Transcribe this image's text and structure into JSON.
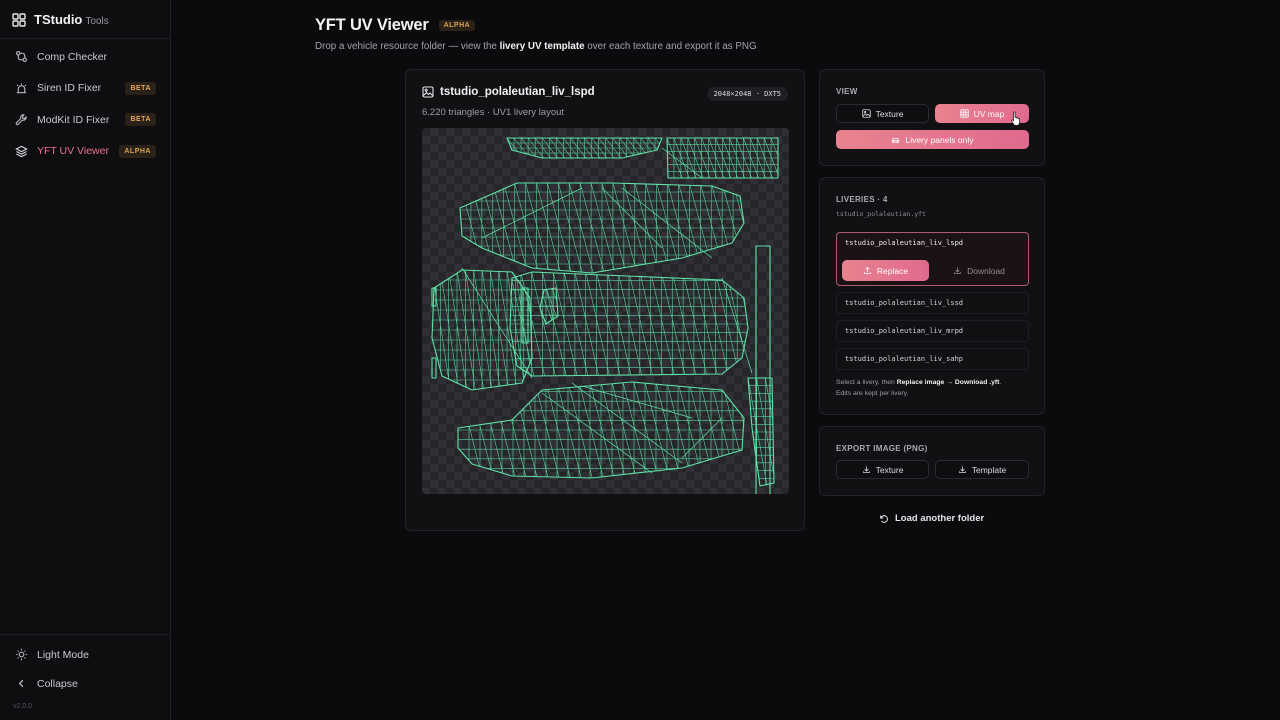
{
  "sidebar": {
    "brand_name": "TStudio",
    "brand_sub": "Tools",
    "items": [
      {
        "label": "Comp Checker",
        "icon": "git-compare-icon",
        "badge": ""
      },
      {
        "label": "Siren ID Fixer",
        "icon": "siren-icon",
        "badge": "BETA"
      },
      {
        "label": "ModKit ID Fixer",
        "icon": "wrench-icon",
        "badge": "BETA"
      },
      {
        "label": "YFT UV Viewer",
        "icon": "layers-icon",
        "badge": "ALPHA"
      }
    ],
    "light_mode_label": "Light Mode",
    "collapse_label": "Collapse",
    "version": "v2.0.0"
  },
  "header": {
    "title": "YFT UV Viewer",
    "badge": "ALPHA",
    "subtitle_pre": "Drop a vehicle resource folder — view the ",
    "subtitle_bold": "livery UV template",
    "subtitle_post": " over each texture and export it as PNG"
  },
  "viewer": {
    "title": "tstudio_polaleutian_liv_lspd",
    "meta": "6.220 triangles · UV1 livery layout",
    "resolution": "2048×2048 · DXT5"
  },
  "view_panel": {
    "label": "VIEW",
    "texture_label": "Texture",
    "uv_map_label": "UV map",
    "livery_only_label": "Livery panels only"
  },
  "liveries": {
    "label": "LIVERIES · 4",
    "file": "tstudio_polaleutian.yft",
    "selected": "tstudio_polaleutian_liv_lspd",
    "replace_label": "Replace",
    "download_label": "Download",
    "others": [
      "tstudio_polaleutian_liv_lssd",
      "tstudio_polaleutian_liv_mrpd",
      "tstudio_polaleutian_liv_sahp"
    ],
    "hint_pre": "Select a livery, then ",
    "hint_bold": "Replace image → Download .yft",
    "hint_post": ".",
    "hint_line2": "Edits are kept per livery."
  },
  "export": {
    "label": "EXPORT IMAGE (PNG)",
    "texture_label": "Texture",
    "template_label": "Template"
  },
  "reload_label": "Load another folder",
  "colors": {
    "accent_pink": "#e06a8e",
    "uv_wire": "#5fe3a8",
    "badge_text": "#e8a65a"
  }
}
